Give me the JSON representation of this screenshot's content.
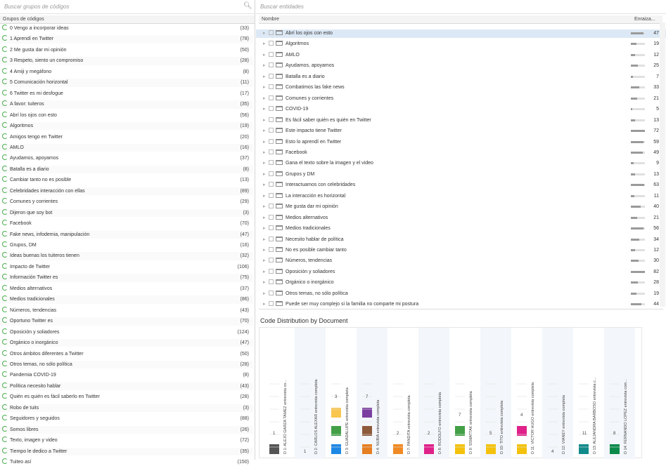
{
  "left_panel": {
    "search_placeholder": "Buscar grupos de códigos",
    "column_header": "Grupos de códigos",
    "items": [
      {
        "label": "0 Vengo a incorporar ideas",
        "count": "(33)"
      },
      {
        "label": "1 Aprendí en Twitter",
        "count": "(78)"
      },
      {
        "label": "2 Me gusta dar mi opinión",
        "count": "(50)"
      },
      {
        "label": "3 Respeto, siento un compromiso",
        "count": "(28)"
      },
      {
        "label": "4 Amiji y megáfono",
        "count": "(8)"
      },
      {
        "label": "5 Comunicación horizontal",
        "count": "(11)"
      },
      {
        "label": "6 Twitter es mi desfogue",
        "count": "(17)"
      },
      {
        "label": "A favor: tuiteros",
        "count": "(35)"
      },
      {
        "label": "Abrí los ojos con esto",
        "count": "(56)"
      },
      {
        "label": "Algoritmos",
        "count": "(19)"
      },
      {
        "label": "Amigos tengo en Twitter",
        "count": "(20)"
      },
      {
        "label": "AMLO",
        "count": "(16)"
      },
      {
        "label": "Ayudamos, apoyamos",
        "count": "(37)"
      },
      {
        "label": "Batalla es a diario",
        "count": "(8)"
      },
      {
        "label": "Cambiar tanto no es posible",
        "count": "(13)"
      },
      {
        "label": "Celebridades interacción con ellas",
        "count": "(89)"
      },
      {
        "label": "Comunes y corrientes",
        "count": "(29)"
      },
      {
        "label": "Dijeron que soy bot",
        "count": "(3)"
      },
      {
        "label": "Facebook",
        "count": "(70)"
      },
      {
        "label": "Fake news, infodemia, manipulación",
        "count": "(47)"
      },
      {
        "label": "Grupos, DM",
        "count": "(16)"
      },
      {
        "label": "Ideas buenas los tuiteros tienen",
        "count": "(32)"
      },
      {
        "label": "Impacto de Twitter",
        "count": "(106)"
      },
      {
        "label": "Información Twitter es",
        "count": "(75)"
      },
      {
        "label": "Medios alternativos",
        "count": "(37)"
      },
      {
        "label": "Medios tradicionales",
        "count": "(86)"
      },
      {
        "label": "Números, tendencias",
        "count": "(43)"
      },
      {
        "label": "Oportuno Twitter es",
        "count": "(70)"
      },
      {
        "label": "Oposición y soliadores",
        "count": "(124)"
      },
      {
        "label": "Orgánico o inorgánico",
        "count": "(47)"
      },
      {
        "label": "Otros ámbitos diferentes a Twitter",
        "count": "(50)"
      },
      {
        "label": "Otros temas, no sólo política",
        "count": "(28)"
      },
      {
        "label": "Pandemia COVID-19",
        "count": "(8)"
      },
      {
        "label": "Política necesito hablar",
        "count": "(43)"
      },
      {
        "label": "Quién es quién es fácil saberlo en Twitter",
        "count": "(28)"
      },
      {
        "label": "Robo de tuits",
        "count": "(3)"
      },
      {
        "label": "Seguidores y seguidos",
        "count": "(88)"
      },
      {
        "label": "Somos libres",
        "count": "(26)"
      },
      {
        "label": "Texto, imagen y video",
        "count": "(72)"
      },
      {
        "label": "Tiempo le dedico a Twitter",
        "count": "(35)"
      },
      {
        "label": "Tuiteo así",
        "count": "(150)"
      }
    ]
  },
  "right_panel": {
    "search_placeholder": "Buscar entidades",
    "col_name": "Nombre",
    "col_count": "Enraiza...",
    "rows": [
      {
        "label": "Abrí los ojos con esto",
        "count": "47",
        "level": 0.9,
        "selected": true
      },
      {
        "label": "Algoritmos",
        "count": "19",
        "level": 0.4
      },
      {
        "label": "AMLO",
        "count": "12",
        "level": 0.3
      },
      {
        "label": "Ayudamos, apoyamos",
        "count": "25",
        "level": 0.5
      },
      {
        "label": "Batalla es a diario",
        "count": "7",
        "level": 0.15
      },
      {
        "label": "Combatimos las fake news",
        "count": "33",
        "level": 0.6
      },
      {
        "label": "Comunes y corrientes",
        "count": "21",
        "level": 0.45
      },
      {
        "label": "COVID-19",
        "count": "5",
        "level": 0.1
      },
      {
        "label": "Es fácil saber quién es quién en Twitter",
        "count": "13",
        "level": 0.3
      },
      {
        "label": "Este impacto tiene Twitter",
        "count": "72",
        "level": 1.0
      },
      {
        "label": "Esto lo aprendí en Twitter",
        "count": "59",
        "level": 0.9
      },
      {
        "label": "Facebook",
        "count": "49",
        "level": 0.85
      },
      {
        "label": "Gana el texto sobre la imagen y el video",
        "count": "9",
        "level": 0.2
      },
      {
        "label": "Grupos y DM",
        "count": "13",
        "level": 0.3
      },
      {
        "label": "Interactuamos con celebridades",
        "count": "63",
        "level": 0.95
      },
      {
        "label": "La interacción es horizontal",
        "count": "11",
        "level": 0.25
      },
      {
        "label": "Me gusta dar mi opinión",
        "count": "40",
        "level": 0.7
      },
      {
        "label": "Medios alternativos",
        "count": "21",
        "level": 0.45
      },
      {
        "label": "Medios tradicionales",
        "count": "56",
        "level": 0.9
      },
      {
        "label": "Necesito hablar de política",
        "count": "34",
        "level": 0.6
      },
      {
        "label": "No es posible cambiar tanto",
        "count": "12",
        "level": 0.3
      },
      {
        "label": "Números, tendencias",
        "count": "30",
        "level": 0.55
      },
      {
        "label": "Oposición y soliadores",
        "count": "82",
        "level": 1.0
      },
      {
        "label": "Orgánico o inorgánico",
        "count": "28",
        "level": 0.5
      },
      {
        "label": "Otros temas, no sólo política",
        "count": "19",
        "level": 0.4
      },
      {
        "label": "Puede ser muy complejo si la familia no comparte mi postura",
        "count": "44",
        "level": 0.75
      }
    ]
  },
  "chart": {
    "title": "Code Distribution by Document"
  },
  "chart_data": {
    "type": "bar",
    "title": "Code Distribution by Document",
    "documents": [
      {
        "name": "D 1: ALEJO GARZA TAMEZ entrevista co...",
        "values": [
          1
        ],
        "colors": [
          "#555555"
        ],
        "label": "1"
      },
      {
        "name": "D 2: CARLOS ALEXAR entrevista completa",
        "values": [],
        "colors": [],
        "label": "1"
      },
      {
        "name": "D 3: GUADALUPE entrevista completa",
        "values": [
          1,
          1,
          1
        ],
        "colors": [
          "#1e88e5",
          "#43a047",
          "#f9c74f"
        ],
        "label": "3"
      },
      {
        "name": "D 4: NUBIA entrevista completa",
        "values": [
          1,
          1,
          1
        ],
        "colors": [
          "#e67e22",
          "#8d5a3b",
          "#7b3fa0"
        ],
        "label": "7"
      },
      {
        "name": "D 7: PANDITA entrevista completa",
        "values": [
          1
        ],
        "colors": [
          "#f08a24"
        ],
        "label": "2"
      },
      {
        "name": "D 8: RODOLFO entrevista completa",
        "values": [
          1
        ],
        "colors": [
          "#e0218a"
        ],
        "label": "2"
      },
      {
        "name": "D 9: SSMATTAK entrevista completa",
        "values": [
          1,
          1
        ],
        "colors": [
          "#f4c20d",
          "#43a047"
        ],
        "label": "7"
      },
      {
        "name": "D 10: TITO entrevista completa",
        "values": [
          1
        ],
        "colors": [
          "#f4c20d"
        ],
        "label": "5"
      },
      {
        "name": "D 11: VICTOR HUGO entrevista completa",
        "values": [
          1,
          1
        ],
        "colors": [
          "#f4c20d",
          "#e0218a"
        ],
        "label": "4"
      },
      {
        "name": "D 12: VIANEY entrevista completa",
        "values": [],
        "colors": [],
        "label": "4"
      },
      {
        "name": "D 13: ALEJANDRA BARBOSO entrevista c...",
        "values": [
          1
        ],
        "colors": [
          "#138a8a"
        ],
        "label": "11"
      },
      {
        "name": "D 14: FERNANDO LOPEZ entrevista com...",
        "values": [
          1
        ],
        "colors": [
          "#0b8a4a"
        ],
        "label": "8"
      }
    ]
  }
}
